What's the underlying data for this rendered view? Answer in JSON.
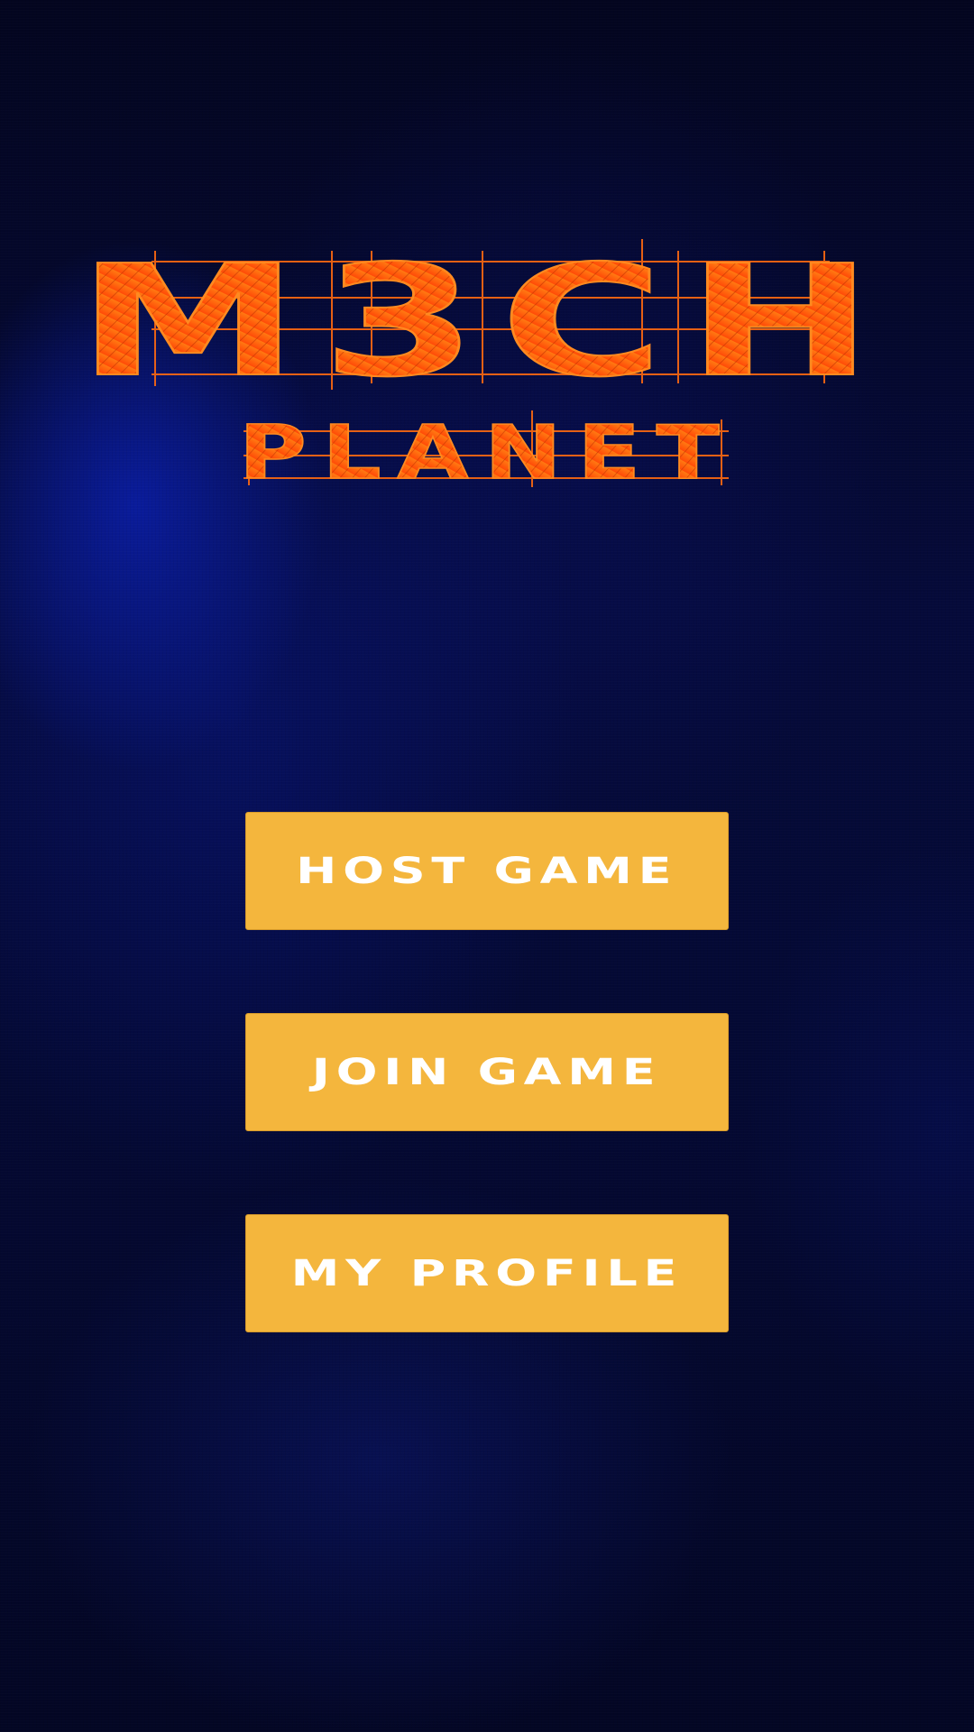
{
  "logo": {
    "line1": "M3CH",
    "line2": "PLANET",
    "color_top": "#ff7a12",
    "color_bottom": "#ff4a08"
  },
  "menu": {
    "buttons": [
      {
        "name": "host-game-button",
        "label": "HOST GAME"
      },
      {
        "name": "join-game-button",
        "label": "JOIN GAME"
      },
      {
        "name": "my-profile-button",
        "label": "MY PROFILE"
      }
    ],
    "button_color": "#f4b63d",
    "label_color": "#ffffff"
  },
  "background": {
    "color": "#03051f",
    "nebula_color": "#0a1eaa"
  }
}
